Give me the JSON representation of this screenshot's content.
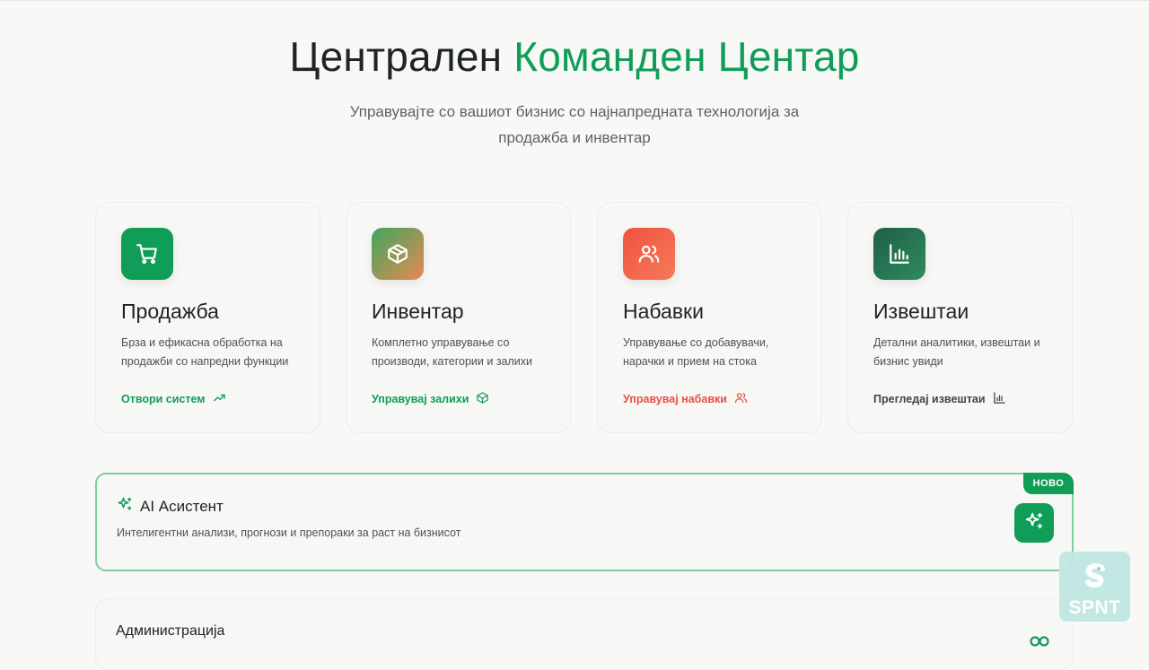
{
  "hero": {
    "title_main": "Централен ",
    "title_accent": "Команден Центар",
    "subtitle": "Управувајте со вашиот бизнис со најнапредната технологија за продажба и инвентар"
  },
  "cards": [
    {
      "title": "Продажба",
      "description": "Брза и ефикасна обработка на продажби со напредни функции",
      "link": "Отвори систем",
      "icon": "cart-icon",
      "link_icon": "trending-up-icon",
      "link_color": "#0f9d58"
    },
    {
      "title": "Инвентар",
      "description": "Комплетно управување со производи, категории и залихи",
      "link": "Управувај залихи",
      "icon": "box-icon",
      "link_icon": "box-icon",
      "link_color": "#0f9d58"
    },
    {
      "title": "Набавки",
      "description": "Управување со добавувачи, нарачки и прием на стока",
      "link": "Управувај набавки",
      "icon": "users-icon",
      "link_icon": "users-icon",
      "link_color": "#e8504a"
    },
    {
      "title": "Извештаи",
      "description": "Детални аналитики, извештаи и бизнис увиди",
      "link": "Прегледај извештаи",
      "icon": "bar-chart-icon",
      "link_icon": "bar-chart-icon",
      "link_color": "#3f4545"
    }
  ],
  "ai": {
    "title": "AI Асистент",
    "description": "Интелигентни анализи, прогнози и препораки за раст на бизнисот",
    "badge": "НОВО",
    "icon": "sparkles-icon"
  },
  "admin": {
    "title": "Администрација",
    "icon": "toggle-icon"
  },
  "watermark": {
    "text": "SPNT"
  },
  "colors": {
    "accent": "#0f9d58",
    "procurement": "#e8504a",
    "text": "#1f2424",
    "muted": "#5b6466"
  }
}
